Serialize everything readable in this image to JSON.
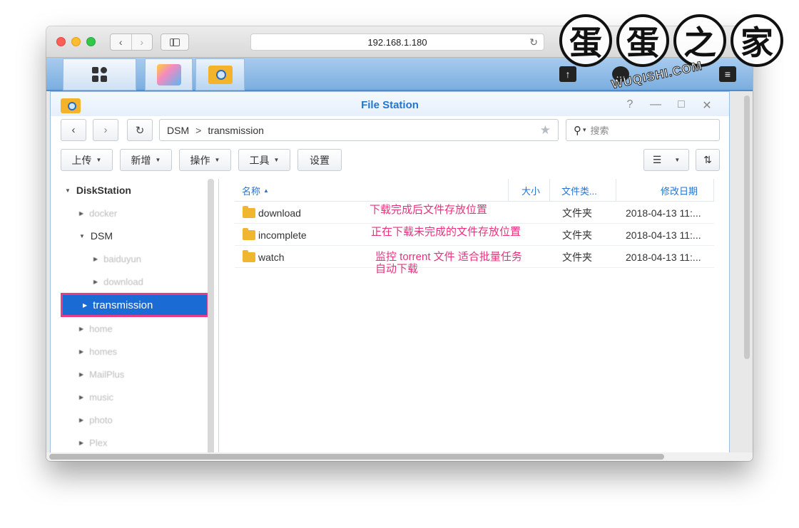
{
  "browser": {
    "url": "192.168.1.180"
  },
  "window": {
    "title": "File Station"
  },
  "path": {
    "root": "DSM",
    "sep": ">",
    "current": "transmission"
  },
  "search": {
    "placeholder": "搜索"
  },
  "toolbar": {
    "upload": "上传",
    "create": "新增",
    "action": "操作",
    "tools": "工具",
    "settings": "设置"
  },
  "tree": {
    "root": "DiskStation",
    "items": [
      {
        "label": "docker"
      },
      {
        "label": "DSM"
      },
      {
        "label": "baiduyun"
      },
      {
        "label": "download"
      },
      {
        "label": "transmission"
      },
      {
        "label": "home"
      },
      {
        "label": "homes"
      },
      {
        "label": "MailPlus"
      },
      {
        "label": "music"
      },
      {
        "label": "photo"
      },
      {
        "label": "Plex"
      }
    ]
  },
  "columns": {
    "name": "名称",
    "size": "大小",
    "type": "文件类...",
    "modified": "修改日期"
  },
  "files": [
    {
      "name": "download",
      "type": "文件夹",
      "modified": "2018-04-13 11:...",
      "note": "下载完成后文件存放位置"
    },
    {
      "name": "incomplete",
      "type": "文件夹",
      "modified": "2018-04-13 11:...",
      "note": "正在下载未完成的文件存放位置"
    },
    {
      "name": "watch",
      "type": "文件夹",
      "modified": "2018-04-13 11:...",
      "note_line1": "监控 torrent 文件 适合批量任务",
      "note_line2": "自动下载"
    }
  ],
  "watermark": {
    "chars": [
      "蛋",
      "蛋",
      "之",
      "家"
    ],
    "site": "WUQISHI.COM"
  },
  "colors": {
    "accent": "#2474d1",
    "selection": "#1b6bd4",
    "highlight_border": "#e83d86",
    "annotation": "#e8327e"
  },
  "icons": {
    "home": "grid-icon",
    "package": "package-center-icon",
    "filestation": "file-station-icon"
  }
}
